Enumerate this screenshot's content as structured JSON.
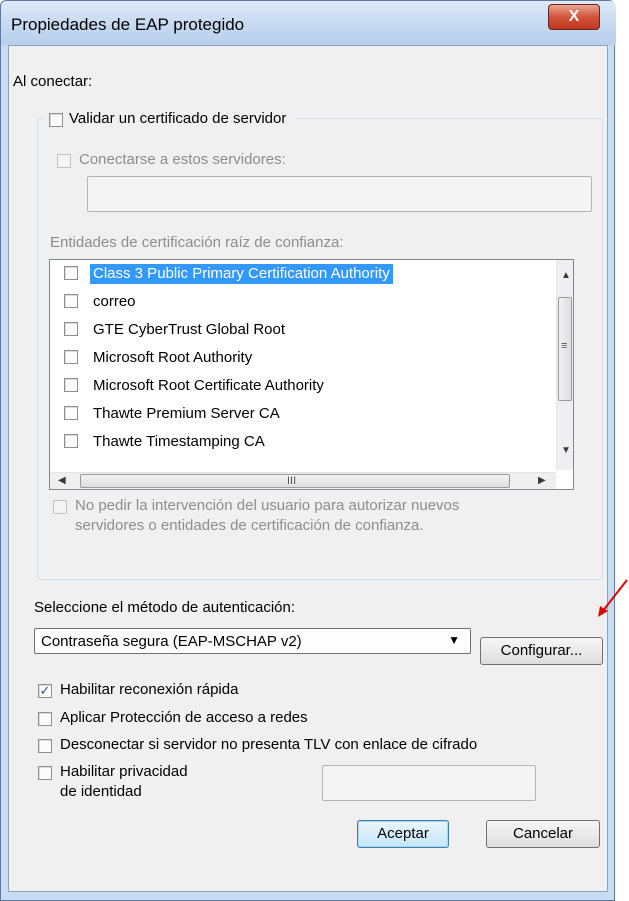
{
  "window": {
    "title": "Propiedades de EAP protegido",
    "close_label": "X"
  },
  "connect": {
    "heading": "Al conectar:",
    "validate_cert_label": "Validar un certificado de servidor",
    "validate_cert_checked": false,
    "connect_servers_label": "Conectarse a estos servidores:",
    "servers_value": "",
    "trusted_ca_label": "Entidades de certificación raíz de confianza:",
    "ca_list": [
      {
        "label": "Class 3 Public Primary Certification Authority",
        "checked": false,
        "selected": true
      },
      {
        "label": "correo",
        "checked": false,
        "selected": false
      },
      {
        "label": "GTE CyberTrust Global Root",
        "checked": false,
        "selected": false
      },
      {
        "label": "Microsoft Root Authority",
        "checked": false,
        "selected": false
      },
      {
        "label": "Microsoft Root Certificate Authority",
        "checked": false,
        "selected": false
      },
      {
        "label": "Thawte Premium Server CA",
        "checked": false,
        "selected": false
      },
      {
        "label": "Thawte Timestamping CA",
        "checked": false,
        "selected": false
      }
    ],
    "no_prompt_label_line1": "No pedir la intervención del usuario para autorizar nuevos",
    "no_prompt_label_line2": "servidores o entidades de certificación de confianza."
  },
  "auth": {
    "method_label": "Seleccione el método de autenticación:",
    "method_value": "Contraseña segura (EAP-MSCHAP v2)",
    "configure_label": "Configurar...",
    "fast_reconnect_label": "Habilitar reconexión rápida",
    "fast_reconnect_checked": true,
    "nap_label": "Aplicar Protección de acceso a redes",
    "nap_checked": false,
    "disconnect_tlv_label": "Desconectar si servidor no presenta TLV con enlace de cifrado",
    "disconnect_tlv_checked": false,
    "identity_privacy_line1": "Habilitar privacidad",
    "identity_privacy_line2": "de identidad",
    "identity_privacy_checked": false
  },
  "buttons": {
    "ok": "Aceptar",
    "cancel": "Cancelar"
  },
  "colors": {
    "selection": "#3399ff",
    "annotation_arrow": "#e00000",
    "checkmark": "#2a4ea2"
  },
  "scroll_icons": {
    "up": "▲",
    "down": "▼",
    "left": "◀",
    "right": "▶",
    "grip_v": "≡",
    "grip_h": "III",
    "combo": "▼"
  }
}
